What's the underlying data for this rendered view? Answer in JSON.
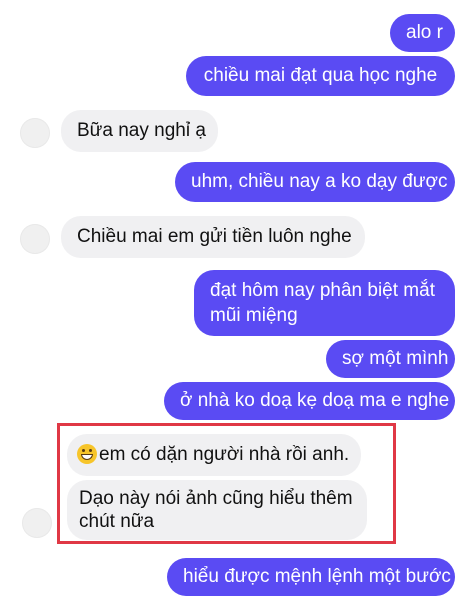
{
  "messages": [
    {
      "from": "me",
      "text": "alo r"
    },
    {
      "from": "me",
      "text": "chiều mai đạt qua học nghe"
    },
    {
      "from": "them",
      "text": "Bữa nay nghỉ ạ"
    },
    {
      "from": "me",
      "text": "uhm, chiều nay a ko dạy được"
    },
    {
      "from": "them",
      "text": "Chiều mai em gửi tiền luôn nghe"
    },
    {
      "from": "me",
      "text": "đạt hôm nay phân biệt mắt mũi miệng"
    },
    {
      "from": "me",
      "text": "sợ một mình"
    },
    {
      "from": "me",
      "text": "ở nhà ko doạ kẹ doạ ma e nghe"
    },
    {
      "from": "them",
      "text": "em có dặn người nhà rồi anh.",
      "emoji": "grinning-face"
    },
    {
      "from": "them",
      "text": "Dạo này nói ảnh cũng hiểu thêm chút nữa"
    },
    {
      "from": "me",
      "text": "hiểu được mệnh lệnh một bước"
    }
  ],
  "colors": {
    "outgoing_bubble": "#5a4bf3",
    "incoming_bubble": "#f0f0f2",
    "highlight_border": "#e03845"
  }
}
